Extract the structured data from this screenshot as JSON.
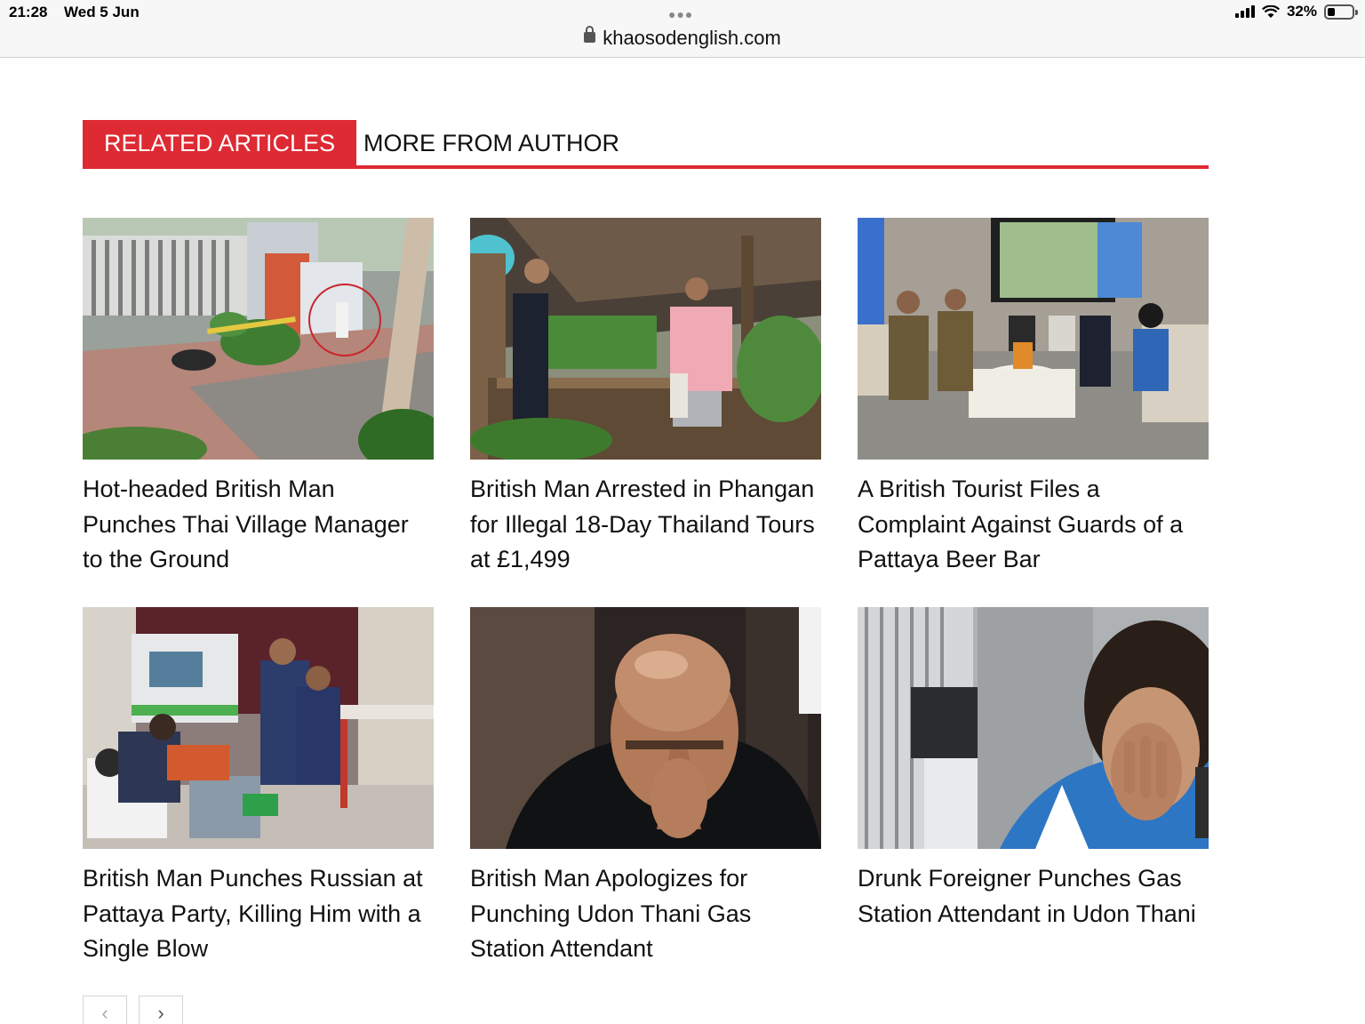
{
  "status_bar": {
    "time": "21:28",
    "date": "Wed 5 Jun",
    "battery_text": "32%",
    "battery_level": 0.32,
    "icons": [
      "signal-icon",
      "wifi-icon",
      "battery-icon"
    ]
  },
  "browser": {
    "url": "khaosodenglish.com",
    "lock_icon": "lock-icon",
    "more_icon": "more-dots-icon"
  },
  "tabs": {
    "active": "RELATED ARTICLES",
    "inactive": "MORE FROM AUTHOR"
  },
  "articles": [
    {
      "title": "Hot-headed British Man Punches Thai Village Manager to the Ground"
    },
    {
      "title": "British Man Arrested in Phangan for Illegal 18-Day Thailand Tours at £1,499"
    },
    {
      "title": "A British Tourist Files a Complaint Against Guards of a Pattaya Beer Bar"
    },
    {
      "title": "British Man Punches Russian at Pattaya Party, Killing Him with a Single Blow"
    },
    {
      "title": "British Man Apologizes for Punching Udon Thani Gas Station Attendant"
    },
    {
      "title": "Drunk Foreigner Punches Gas Station Attendant in Udon Thani"
    }
  ],
  "pagination": {
    "prev_symbol": "‹",
    "next_symbol": "›"
  },
  "colors": {
    "accent": "#dd2a33",
    "text": "#111111",
    "background": "#ffffff"
  }
}
